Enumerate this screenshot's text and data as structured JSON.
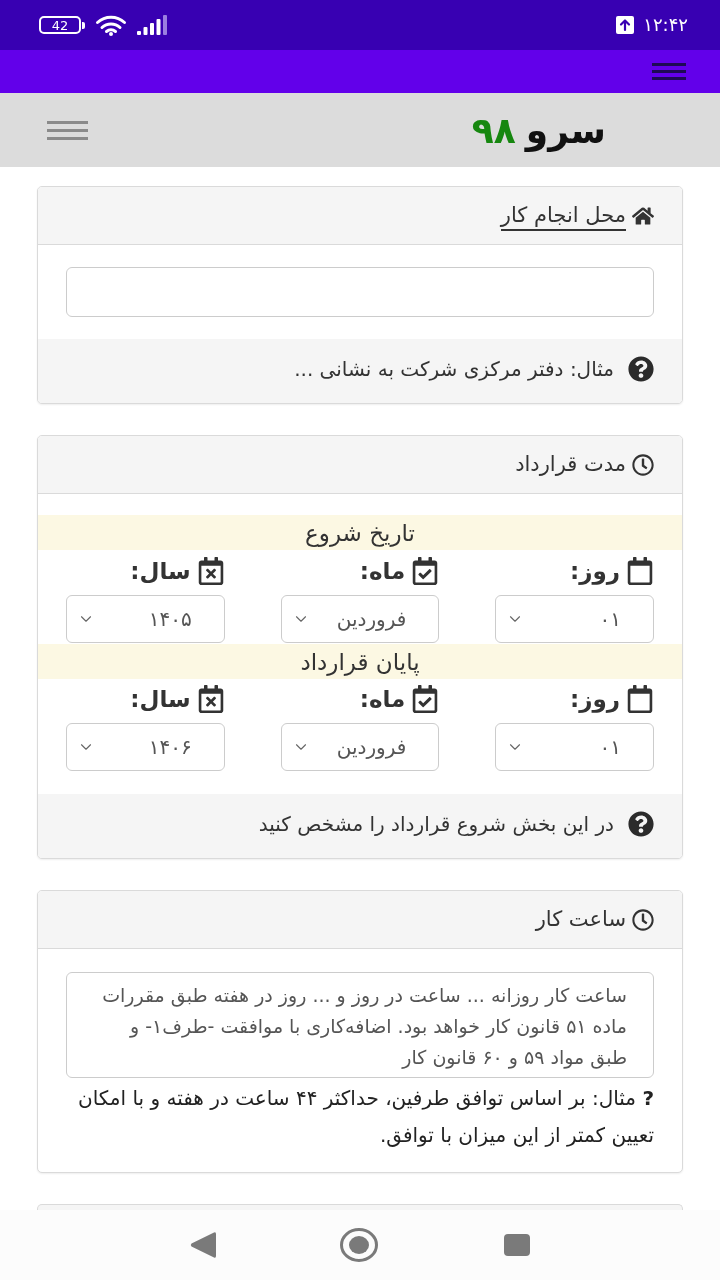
{
  "status_bar": {
    "time": "۱۲:۴۲",
    "battery": "42"
  },
  "header": {
    "brand_name": "سرو",
    "brand_number": "۹۸"
  },
  "cards": [
    {
      "kind": "text_input",
      "title": "محل انجام کار",
      "linked": true,
      "hint": "مثال: دفتر مرکزی شرکت به نشانی ..."
    },
    {
      "kind": "date_range",
      "title": "مدت قرارداد",
      "linked": false,
      "ranges": [
        {
          "heading": "تاریخ شروع",
          "fields": [
            {
              "kind": "day",
              "label": "روز:",
              "value": "۰۱"
            },
            {
              "kind": "month",
              "label": "ماه:",
              "value": "فروردین"
            },
            {
              "kind": "year",
              "label": "سال:",
              "value": "۱۴۰۵"
            }
          ]
        },
        {
          "heading": "پایان قرارداد",
          "fields": [
            {
              "kind": "day",
              "label": "روز:",
              "value": "۰۱"
            },
            {
              "kind": "month",
              "label": "ماه:",
              "value": "فروردین"
            },
            {
              "kind": "year",
              "label": "سال:",
              "value": "۱۴۰۶"
            }
          ]
        }
      ],
      "hint": "در این بخش شروع قرارداد را مشخص کنید"
    },
    {
      "kind": "textarea",
      "title": "ساعت کار",
      "linked": false,
      "value": "ساعت کار روزانه ... ساعت در روز و ... روز در هفته طبق مقررات ماده ۵۱ قانون کار خواهد بود. اضافه‌کاری با موافقت -طرف۱- و طبق مواد ۵۹ و ۶۰ قانون کار",
      "hint": "**?** مثال: بر اساس توافق طرفین، حداکثر ۴۴ ساعت در هفته و با امکان تعیین کمتر از این میزان با توافق."
    }
  ]
}
